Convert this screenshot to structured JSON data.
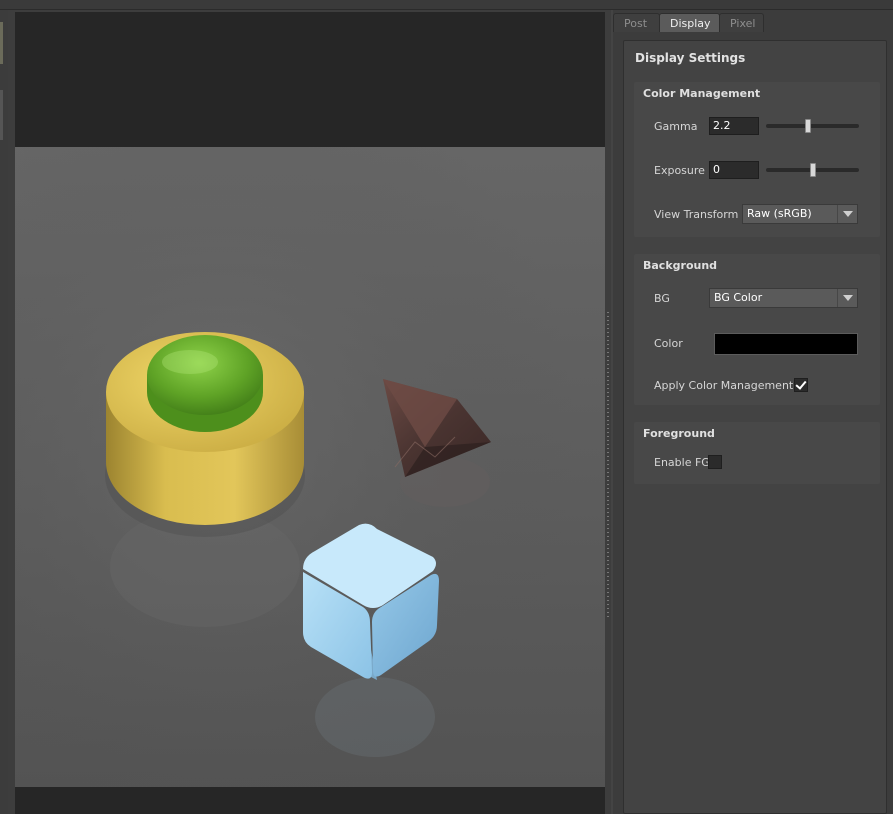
{
  "tabs": [
    {
      "label": "Post",
      "active": false
    },
    {
      "label": "Display",
      "active": true
    },
    {
      "label": "Pixel",
      "active": false
    }
  ],
  "panel": {
    "title": "Display Settings",
    "color_management": {
      "title": "Color Management",
      "gamma": {
        "label": "Gamma",
        "value": "2.2",
        "slider_fraction": 0.45
      },
      "exposure": {
        "label": "Exposure",
        "value": "0",
        "slider_fraction": 0.5
      },
      "view_transform": {
        "label": "View Transform",
        "value": "Raw (sRGB)"
      }
    },
    "background": {
      "title": "Background",
      "bg": {
        "label": "BG",
        "value": "BG Color"
      },
      "color": {
        "label": "Color",
        "value": "#000000"
      },
      "apply_cm": {
        "label": "Apply Color Management",
        "checked": true
      }
    },
    "foreground": {
      "title": "Foreground",
      "enable_fg": {
        "label": "Enable FG",
        "checked": false
      }
    }
  },
  "colors": {
    "panel_bg": "#3c3c3c",
    "group_bg": "#484848",
    "active_tab": "#5b5b5b",
    "viewport_bg": "#262626",
    "render_floor": "#5a5a5a",
    "cylinder": "#d6b94a",
    "glass_disc": "#6cae2c",
    "cube": "#9fd0ee",
    "diamond": "#5a3a36"
  },
  "icons": [
    "dropdown-arrow-icon",
    "checkmark-icon"
  ]
}
